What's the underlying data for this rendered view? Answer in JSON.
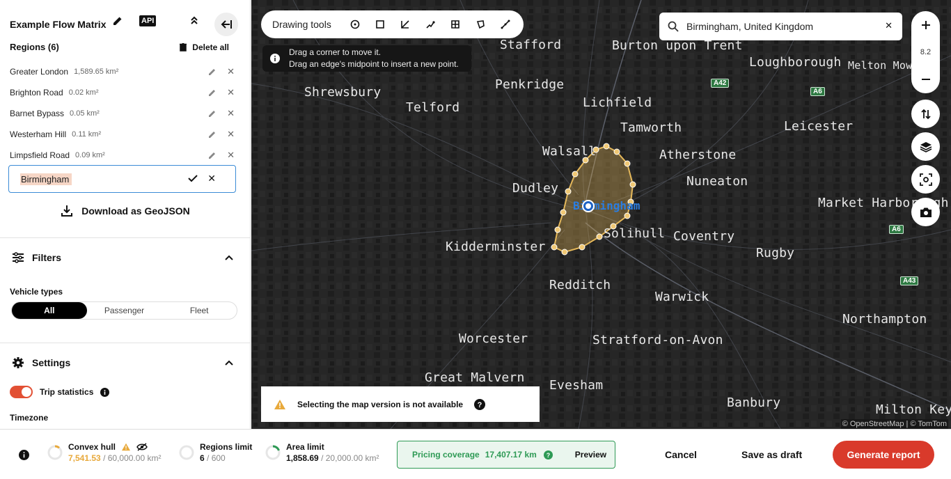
{
  "sidebar": {
    "title": "Example Flow Matrix",
    "api_label": "API",
    "regions_title": "Regions (6)",
    "delete_all": "Delete all",
    "regions": [
      {
        "name": "Greater London",
        "area": "1,589.65 km²"
      },
      {
        "name": "Brighton Road",
        "area": "0.02 km²"
      },
      {
        "name": "Barnet Bypass",
        "area": "0.05 km²"
      },
      {
        "name": "Westerham Hill",
        "area": "0.11 km²"
      },
      {
        "name": "Limpsfield Road",
        "area": "0.09 km²"
      }
    ],
    "new_region_value": "Birmingham",
    "download_label": "Download as GeoJSON",
    "filters_label": "Filters",
    "vehicle_types_label": "Vehicle types",
    "vehicle_types": [
      "All",
      "Passenger",
      "Fleet"
    ],
    "vehicle_type_selected": "All",
    "settings_label": "Settings",
    "trip_statistics_label": "Trip statistics",
    "trip_statistics_enabled": true,
    "timezone_label": "Timezone"
  },
  "map": {
    "drawing_tools_label": "Drawing tools",
    "hint_line1": "Drag a corner to move it.",
    "hint_line2": "Drag an edge's midpoint to insert a new point.",
    "search_value": "Birmingham, United Kingdom",
    "zoom_level": "8.2",
    "warning": "Selecting the map version is not available",
    "attribution": "© OpenStreetMap | © TomTom",
    "selected_label": "Birmingham",
    "cities": [
      "Stafford",
      "Burton upon Trent",
      "Loughborough",
      "Melton Mowbray",
      "Shrewsbury",
      "Penkridge",
      "Telford",
      "Lichfield",
      "Tamworth",
      "Leicester",
      "Walsall",
      "Atherstone",
      "Dudley",
      "Nuneaton",
      "Market Harborough",
      "Solihull",
      "Kidderminster",
      "Coventry",
      "Rugby",
      "Redditch",
      "Warwick",
      "Northampton",
      "Worcester",
      "Stratford-on-Avon",
      "Great Malvern",
      "Evesham",
      "Banbury",
      "Milton Keyn"
    ],
    "roads": [
      "A42",
      "A6",
      "A6",
      "A43"
    ],
    "colors": {
      "background": "#232323",
      "selection": "#e5b85a"
    }
  },
  "bottombar": {
    "convex_hull_label": "Convex hull",
    "convex_hull_value": "7,541.53",
    "convex_hull_limit": "/ 60,000.00 km²",
    "regions_limit_label": "Regions limit",
    "regions_limit_value": "6",
    "regions_limit_max": "/ 600",
    "area_limit_label": "Area limit",
    "area_limit_value": "1,858.69",
    "area_limit_max": "/ 20,000.00 km²",
    "pricing_label": "Pricing coverage",
    "pricing_value": "17,407.17 km",
    "preview_label": "Preview",
    "cancel_label": "Cancel",
    "save_draft_label": "Save as draft",
    "generate_label": "Generate report",
    "accent": "#d93a2b"
  }
}
